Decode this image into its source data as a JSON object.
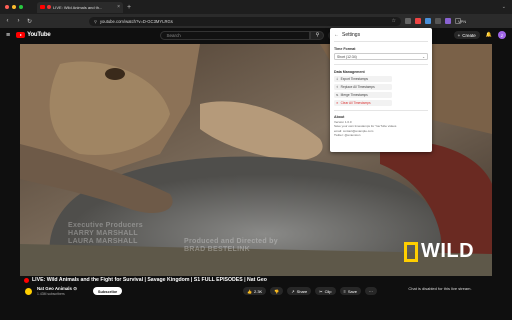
{
  "browser": {
    "tab_title": "LIVE: Wild Animals and th...",
    "tab_close": "×",
    "new_tab": "+",
    "tab_menu": "⌄",
    "nav": {
      "back": "‹",
      "forward": "›",
      "reload": "↻",
      "home": "⌂"
    },
    "url": "youtube.com/watch?v=D-GC3MYLRGs",
    "vpn_label": "VPN",
    "lock": "⚲",
    "star": "☆"
  },
  "youtube": {
    "menu_icon": "≡",
    "logo_text": "YouTube",
    "search_placeholder": "Search",
    "search_icon": "⚲",
    "mic_icon": "●",
    "create_label": "Create",
    "create_icon": "+",
    "bell_icon": "🔔",
    "avatar_letter": "Z"
  },
  "video_overlay": {
    "credit_left_line1": "Executive Producers",
    "credit_left_line2": "HARRY MARSHALL",
    "credit_left_line3": "LAURA MARSHALL",
    "credit_right_line1": "Produced and Directed by",
    "credit_right_line2": "BRAD BESTELINK",
    "brand_word": "WILD"
  },
  "settings_panel": {
    "back_icon": "←",
    "title": "Settings",
    "time_format_label": "Time Format",
    "time_format_value": "Short (12:34)",
    "time_format_chevron": "⌄",
    "data_mgmt_label": "Data Management",
    "buttons": [
      {
        "icon": "⇩",
        "label": "Export Timestamps"
      },
      {
        "icon": "⇧",
        "label": "Replace All Timestamps"
      },
      {
        "icon": "⇅",
        "label": "Merge Timestamps"
      },
      {
        "icon": "✕",
        "label": "Clear All Timestamps"
      }
    ],
    "about_label": "About",
    "about_lines": [
      "Version 1.0.0",
      "Save your own timestamps for YouTube videos",
      "email: contact@example.com",
      "Twitter: @extension"
    ]
  },
  "video_info": {
    "title": "LIVE: Wild Animals and the Fight for Survival | Savage Kingdom | S1 FULL EPISODES | Nat Geo",
    "channel_name": "Nat Geo Animals ⊙",
    "subscribers": "1.43M subscribers",
    "subscribe_label": "Subscribe",
    "like_count": "2.3K",
    "like_icon": "👍",
    "dislike_icon": "👎",
    "share_label": "Share",
    "share_icon": "↗",
    "clip_label": "Clip",
    "clip_icon": "✂",
    "save_label": "Save",
    "save_icon": "≡",
    "more_icon": "···",
    "chat_disabled": "Chat is disabled for this live stream."
  },
  "colors": {
    "youtube_red": "#ff0000",
    "natgeo_yellow": "#ffce00",
    "dark_bg": "#0f0f0f"
  }
}
